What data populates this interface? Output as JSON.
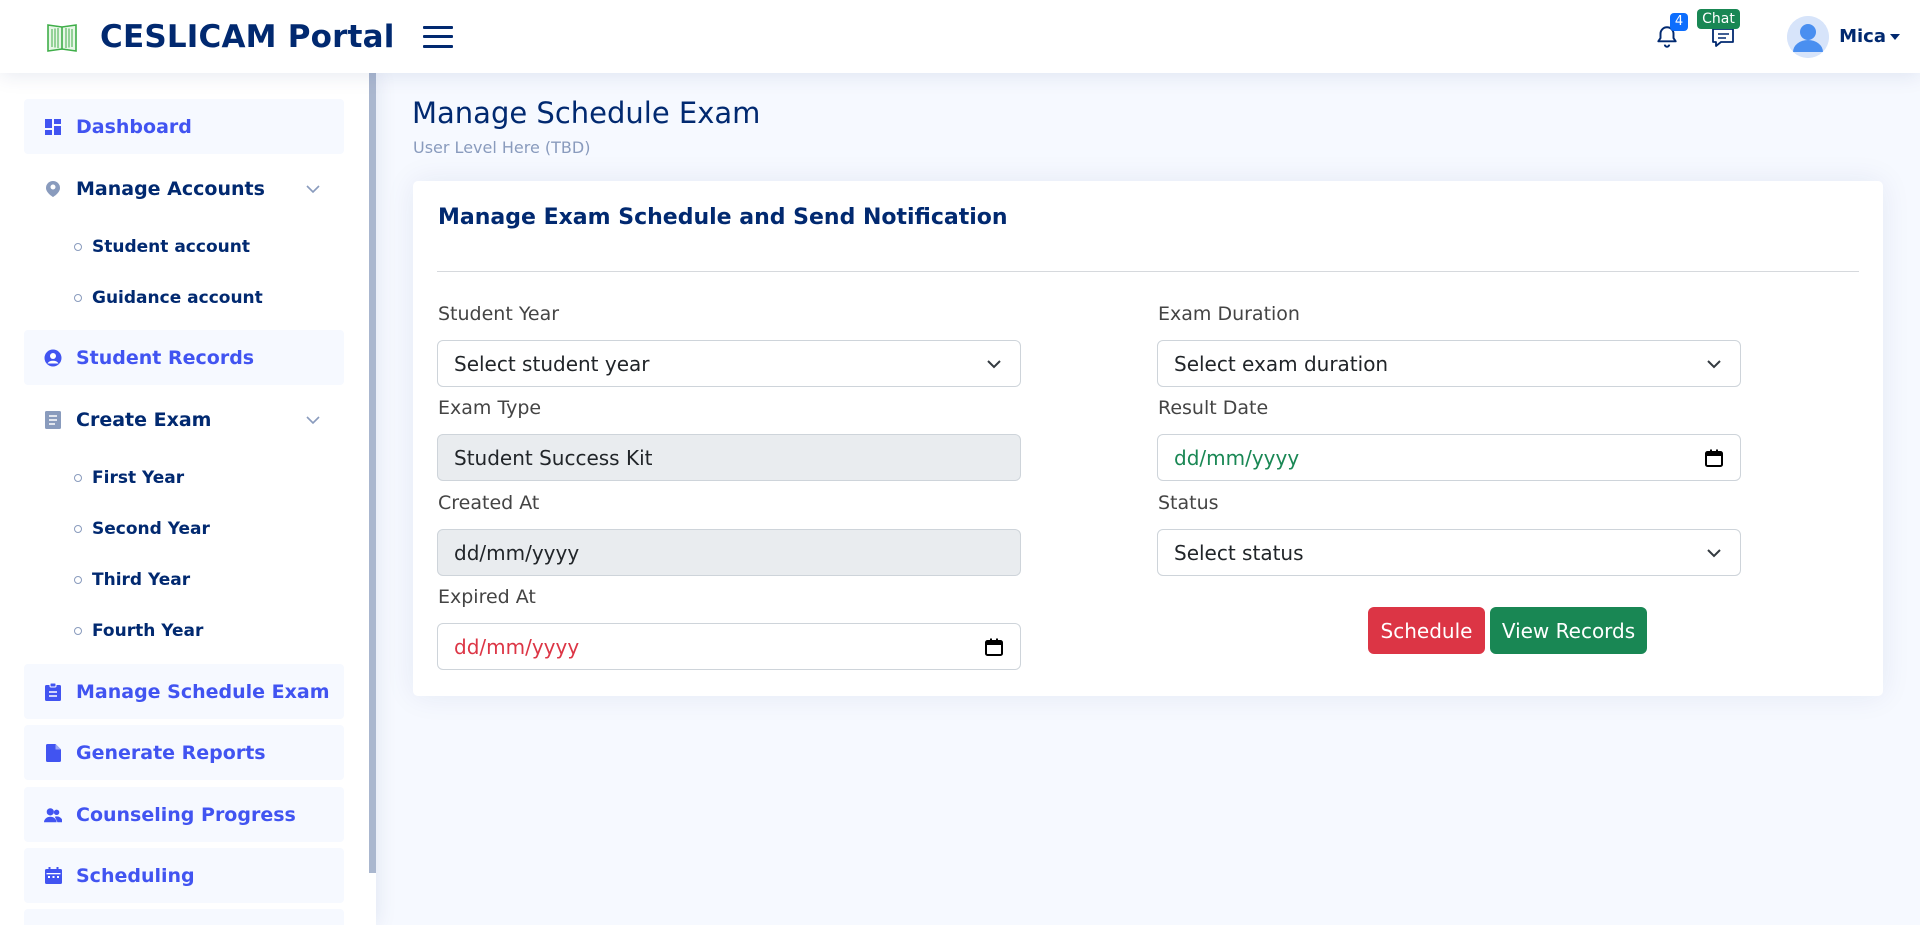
{
  "header": {
    "brand": "CESLICAM Portal",
    "notifications_count": "4",
    "chat_label": "Chat",
    "user_name": "Mica"
  },
  "sidebar": {
    "items": [
      {
        "label": "Dashboard",
        "icon": "grid-icon"
      },
      {
        "label": "Manage Accounts",
        "icon": "person-pin-icon",
        "expanded": true,
        "children": [
          "Student account",
          "Guidance account"
        ]
      },
      {
        "label": "Student Records",
        "icon": "person-circle-icon"
      },
      {
        "label": "Create Exam",
        "icon": "document-icon",
        "expanded": true,
        "children": [
          "First Year",
          "Second Year",
          "Third Year",
          "Fourth Year"
        ]
      },
      {
        "label": "Manage Schedule Exam",
        "icon": "clipboard-icon"
      },
      {
        "label": "Generate Reports",
        "icon": "file-icon"
      },
      {
        "label": "Counseling Progress",
        "icon": "people-icon"
      },
      {
        "label": "Scheduling",
        "icon": "calendar-icon"
      }
    ]
  },
  "page": {
    "title": "Manage Schedule Exam",
    "subtitle": "User Level Here (TBD)"
  },
  "card": {
    "title": "Manage Exam Schedule and Send Notification",
    "student_year": {
      "label": "Student Year",
      "value": "Select student year"
    },
    "exam_type": {
      "label": "Exam Type",
      "value": "Student Success Kit"
    },
    "created_at": {
      "label": "Created At",
      "value": "dd/mm/yyyy"
    },
    "expired_at": {
      "label": "Expired At",
      "value": "dd/mm/yyyy"
    },
    "exam_duration": {
      "label": "Exam Duration",
      "value": "Select exam duration"
    },
    "result_date": {
      "label": "Result Date",
      "value": "dd/mm/yyyy"
    },
    "status": {
      "label": "Status",
      "value": "Select status"
    },
    "schedule_button": "Schedule",
    "view_records_button": "View Records"
  },
  "colors": {
    "primary_nav": "#4154f1",
    "dark_navy": "#012970",
    "danger": "#dc3545",
    "success": "#198754",
    "badge_blue": "#0d6efd"
  }
}
